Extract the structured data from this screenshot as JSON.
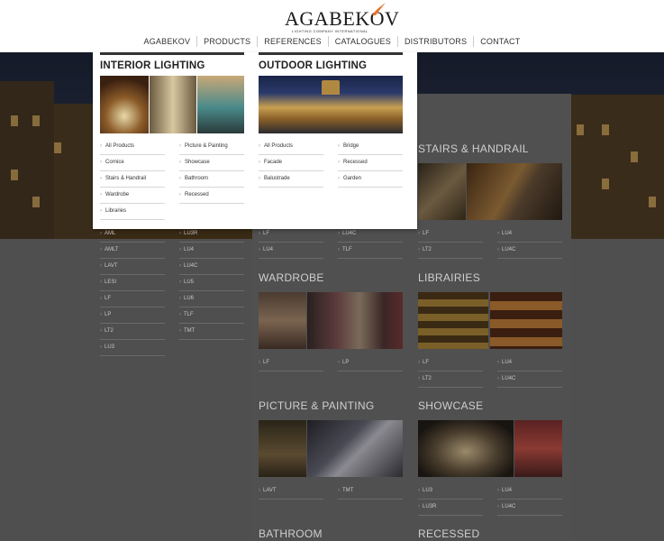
{
  "header": {
    "logo_text": "AGABEKOV",
    "logo_subtitle": "LIGHTING COMPANY INTERNATIONAL",
    "nav": [
      "AGABEKOV",
      "PRODUCTS",
      "REFERENCES",
      "CATALOGUES",
      "DISTRIBUTORS",
      "CONTACT"
    ]
  },
  "dropdown": {
    "interior": {
      "title": "INTERIOR LIGHTING",
      "col1": [
        "All Products",
        "Cornice",
        "Stairs & Handrail",
        "Wardrobe",
        "Libraries"
      ],
      "col2": [
        "Picture & Painting",
        "Showcase",
        "Bathroom",
        "Recessed"
      ]
    },
    "outdoor": {
      "title": "OUTDOOR LIGHTING",
      "col1": [
        "All Products",
        "Facade",
        "Balustrade"
      ],
      "col2": [
        "Bridge",
        "Recessed",
        "Garden"
      ]
    }
  },
  "catalog": {
    "left_col1": [
      "AML",
      "AMLT",
      "LAVT",
      "LESI",
      "LF",
      "LP",
      "LT2",
      "LU3"
    ],
    "left_col2": [
      "LU3R",
      "LU4",
      "LU4C",
      "LU5",
      "LU6",
      "TLF",
      "TMT"
    ],
    "cornice_col1": [
      "LF",
      "LU4"
    ],
    "cornice_col2": [
      "LU4C",
      "TLF"
    ],
    "stairs": {
      "title": "STAIRS & HANDRAIL",
      "col1": [
        "LF",
        "LT2"
      ],
      "col2": [
        "LU4",
        "LU4C"
      ]
    },
    "wardrobe": {
      "title": "WARDROBE",
      "col1": [
        "LF"
      ],
      "col2": [
        "LP"
      ]
    },
    "libraries": {
      "title": "LIBRAIRIES",
      "col1": [
        "LF",
        "LT2"
      ],
      "col2": [
        "LU4",
        "LU4C"
      ]
    },
    "picture": {
      "title": "PICTURE & PAINTING",
      "col1": [
        "LAVT"
      ],
      "col2": [
        "TMT"
      ]
    },
    "showcase": {
      "title": "SHOWCASE",
      "col1": [
        "LU3",
        "LU3R"
      ],
      "col2": [
        "LU4",
        "LU4C"
      ]
    },
    "bathroom": {
      "title": "BATHROOM"
    },
    "recessed": {
      "title": "RECESSED"
    }
  },
  "colors": {
    "accent_flame": "#e8742a",
    "menu_bar": "#333333",
    "overlay": "#4f4f4f"
  }
}
